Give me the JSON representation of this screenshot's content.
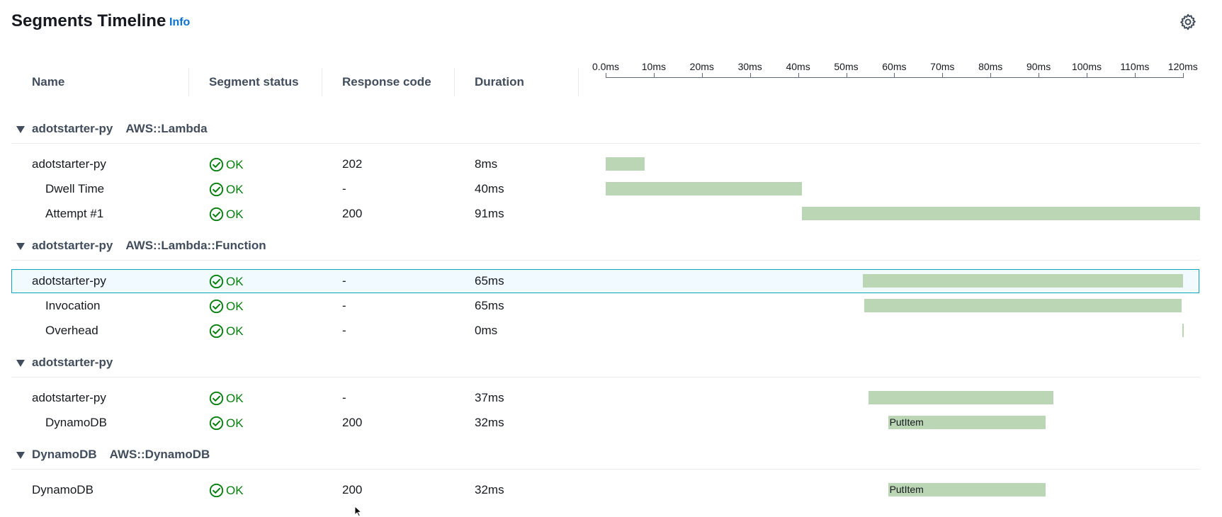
{
  "header": {
    "title": "Segments Timeline",
    "info_link": "Info",
    "settings_icon": "gear-icon"
  },
  "columns": {
    "name": "Name",
    "segment_status": "Segment status",
    "response_code": "Response code",
    "duration": "Duration"
  },
  "timeline": {
    "axis_min_ms": 0,
    "axis_max_ms": 120,
    "ticks": [
      "0.0ms",
      "10ms",
      "20ms",
      "30ms",
      "40ms",
      "50ms",
      "60ms",
      "70ms",
      "80ms",
      "90ms",
      "100ms",
      "110ms",
      "120ms"
    ]
  },
  "colors": {
    "ok_green": "#037f0c",
    "bar_green": "#bad6b5",
    "link_blue": "#0972d3",
    "highlight_border": "#0aa5c2",
    "highlight_bg": "#f1faff"
  },
  "groups": [
    {
      "name": "adotstarter-py",
      "type": "AWS::Lambda",
      "rows": [
        {
          "name": "adotstarter-py",
          "indent": 0,
          "status": "OK",
          "response_code": "202",
          "duration": "8ms",
          "bar_start_ms": 0,
          "bar_end_ms": 8.1,
          "bar_label": "",
          "selected": false
        },
        {
          "name": "Dwell Time",
          "indent": 1,
          "status": "OK",
          "response_code": "-",
          "duration": "40ms",
          "bar_start_ms": 0,
          "bar_end_ms": 40.8,
          "bar_label": "",
          "selected": false
        },
        {
          "name": "Attempt #1",
          "indent": 1,
          "status": "OK",
          "response_code": "200",
          "duration": "91ms",
          "bar_start_ms": 40.8,
          "bar_end_ms": 123.6,
          "bar_label": "",
          "selected": false
        }
      ]
    },
    {
      "name": "adotstarter-py",
      "type": "AWS::Lambda::Function",
      "rows": [
        {
          "name": "adotstarter-py",
          "indent": 0,
          "status": "OK",
          "response_code": "-",
          "duration": "65ms",
          "bar_start_ms": 53.5,
          "bar_end_ms": 120.1,
          "bar_label": "",
          "selected": true
        },
        {
          "name": "Invocation",
          "indent": 1,
          "status": "OK",
          "response_code": "-",
          "duration": "65ms",
          "bar_start_ms": 53.7,
          "bar_end_ms": 119.7,
          "bar_label": "",
          "selected": false
        },
        {
          "name": "Overhead",
          "indent": 1,
          "status": "OK",
          "response_code": "-",
          "duration": "0ms",
          "bar_start_ms": 119.9,
          "bar_end_ms": 120.2,
          "bar_label": "",
          "selected": false
        }
      ]
    },
    {
      "name": "adotstarter-py",
      "type": "",
      "rows": [
        {
          "name": "adotstarter-py",
          "indent": 0,
          "status": "OK",
          "response_code": "-",
          "duration": "37ms",
          "bar_start_ms": 54.7,
          "bar_end_ms": 93.1,
          "bar_label": "",
          "selected": false
        },
        {
          "name": "DynamoDB",
          "indent": 1,
          "status": "OK",
          "response_code": "200",
          "duration": "32ms",
          "bar_start_ms": 58.7,
          "bar_end_ms": 91.4,
          "bar_label": "PutItem",
          "selected": false
        }
      ]
    },
    {
      "name": "DynamoDB",
      "type": "AWS::DynamoDB",
      "rows": [
        {
          "name": "DynamoDB",
          "indent": 0,
          "status": "OK",
          "response_code": "200",
          "duration": "32ms",
          "bar_start_ms": 58.7,
          "bar_end_ms": 91.4,
          "bar_label": "PutItem",
          "selected": false
        }
      ]
    }
  ]
}
